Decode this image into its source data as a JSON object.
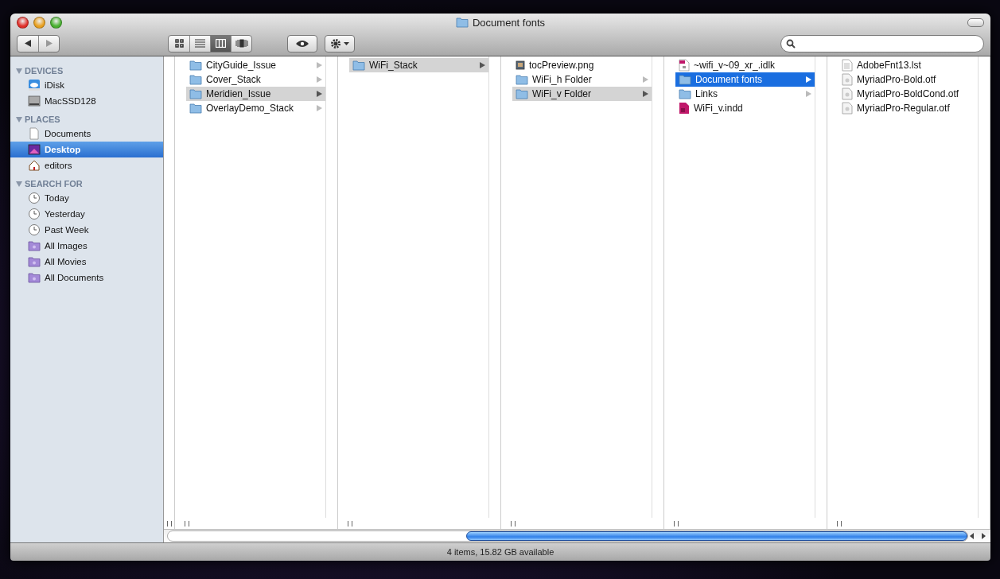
{
  "window": {
    "title": "Document fonts"
  },
  "toolbar": {
    "nav": [
      {
        "kind": "back",
        "disabled": false
      },
      {
        "kind": "forward",
        "disabled": true
      }
    ],
    "views": [
      {
        "kind": "icons",
        "selected": false
      },
      {
        "kind": "list",
        "selected": false
      },
      {
        "kind": "columns",
        "selected": true
      },
      {
        "kind": "coverflow",
        "selected": false
      }
    ]
  },
  "sidebar": {
    "sections": [
      {
        "heading": "DEVICES",
        "items": [
          {
            "label": "iDisk",
            "kind": "idisk",
            "selected": false
          },
          {
            "label": "MacSSD128",
            "kind": "drive",
            "selected": false
          }
        ]
      },
      {
        "heading": "PLACES",
        "items": [
          {
            "label": "Documents",
            "kind": "documents",
            "selected": false
          },
          {
            "label": "Desktop",
            "kind": "desktop",
            "selected": true
          },
          {
            "label": "editors",
            "kind": "home",
            "selected": false
          }
        ]
      },
      {
        "heading": "SEARCH FOR",
        "items": [
          {
            "label": "Today",
            "kind": "clock",
            "selected": false
          },
          {
            "label": "Yesterday",
            "kind": "clock",
            "selected": false
          },
          {
            "label": "Past Week",
            "kind": "clock",
            "selected": false
          },
          {
            "label": "All Images",
            "kind": "smart",
            "selected": false
          },
          {
            "label": "All Movies",
            "kind": "smart",
            "selected": false
          },
          {
            "label": "All Documents",
            "kind": "smart",
            "selected": false
          }
        ]
      }
    ]
  },
  "columns": [
    {
      "items": [
        {
          "name": "CityGuide_Issue",
          "kind": "folder",
          "selected": false,
          "active": false
        },
        {
          "name": "Cover_Stack",
          "kind": "folder",
          "selected": false,
          "active": false
        },
        {
          "name": "Meridien_Issue",
          "kind": "folder",
          "selected": true,
          "active": false
        },
        {
          "name": "OverlayDemo_Stack",
          "kind": "folder",
          "selected": false,
          "active": false
        }
      ]
    },
    {
      "items": [
        {
          "name": "WiFi_Stack",
          "kind": "folder",
          "selected": true,
          "active": false
        }
      ]
    },
    {
      "items": [
        {
          "name": "tocPreview.png",
          "kind": "image",
          "selected": false,
          "active": false
        },
        {
          "name": "WiFi_h Folder",
          "kind": "folder",
          "selected": false,
          "active": false
        },
        {
          "name": "WiFi_v Folder",
          "kind": "folder",
          "selected": true,
          "active": false
        }
      ]
    },
    {
      "items": [
        {
          "name": "~wifi_v~09_xr_.idlk",
          "kind": "lock",
          "selected": false,
          "active": false
        },
        {
          "name": "Document fonts",
          "kind": "folder",
          "selected": true,
          "active": true
        },
        {
          "name": "Links",
          "kind": "folder",
          "selected": false,
          "active": false
        },
        {
          "name": "WiFi_v.indd",
          "kind": "indesign",
          "selected": false,
          "active": false
        }
      ]
    },
    {
      "items": [
        {
          "name": "AdobeFnt13.lst",
          "kind": "text",
          "selected": false,
          "active": false
        },
        {
          "name": "MyriadPro-Bold.otf",
          "kind": "font",
          "selected": false,
          "active": false
        },
        {
          "name": "MyriadPro-BoldCond.otf",
          "kind": "font",
          "selected": false,
          "active": false
        },
        {
          "name": "MyriadPro-Regular.otf",
          "kind": "font",
          "selected": false,
          "active": false
        }
      ]
    }
  ],
  "status_bar": "4 items, 15.82 GB available"
}
